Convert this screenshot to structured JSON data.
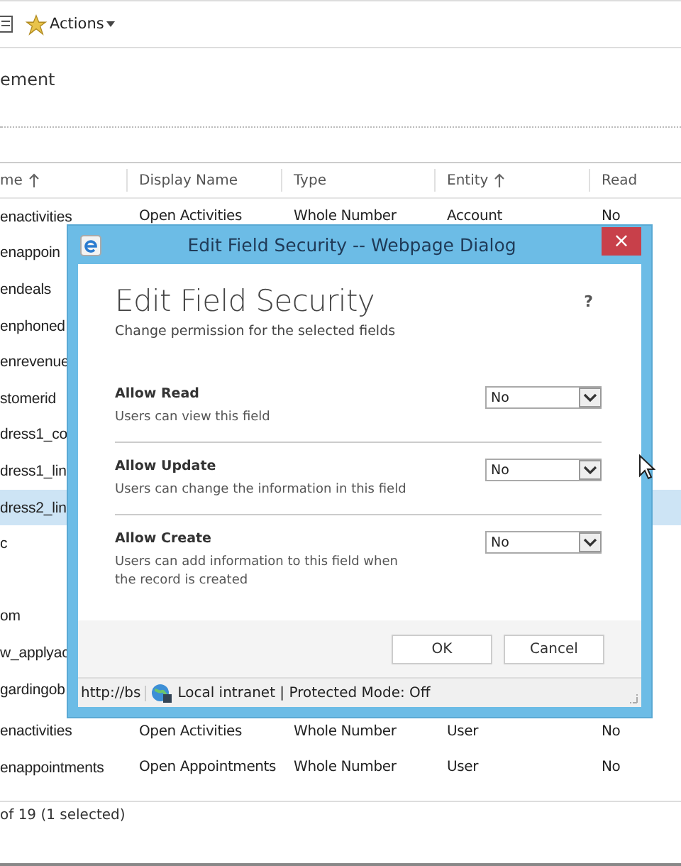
{
  "toolbar": {
    "actions_label": "Actions"
  },
  "page_title": "ement",
  "table": {
    "columns": [
      {
        "label": "me",
        "sorted": true
      },
      {
        "label": "Display Name",
        "sorted": false
      },
      {
        "label": "Type",
        "sorted": false
      },
      {
        "label": "Entity",
        "sorted": true
      },
      {
        "label": "Read",
        "sorted": false
      }
    ],
    "rows": [
      {
        "selected": false,
        "cells": [
          "enactivities",
          "Open Activities",
          "Whole Number",
          "Account",
          "No"
        ]
      },
      {
        "selected": false,
        "cells": [
          "enappoin"
        ]
      },
      {
        "selected": false,
        "cells": [
          "endeals"
        ]
      },
      {
        "selected": false,
        "cells": [
          "enphoned"
        ]
      },
      {
        "selected": false,
        "cells": [
          "enrevenue"
        ]
      },
      {
        "selected": false,
        "cells": [
          "stomerid"
        ]
      },
      {
        "selected": false,
        "cells": [
          "dress1_co"
        ]
      },
      {
        "selected": false,
        "cells": [
          "dress1_lin"
        ]
      },
      {
        "selected": true,
        "cells": [
          "dress2_lin"
        ]
      },
      {
        "selected": false,
        "cells": [
          "c"
        ]
      },
      {
        "selected": false
      },
      {
        "selected": false,
        "cells": [
          "om"
        ]
      },
      {
        "selected": false,
        "cells": [
          "w_applyac"
        ]
      },
      {
        "selected": false,
        "cells": [
          "gardingob"
        ]
      },
      {
        "selected": false,
        "cells": [
          "enactivities",
          "Open Activities",
          "Whole Number",
          "User",
          "No"
        ]
      },
      {
        "selected": false,
        "cells": [
          "enappointments",
          "Open Appointments",
          "Whole Number",
          "User",
          "No"
        ]
      }
    ]
  },
  "record_count": "of 19 (1 selected)",
  "dialog": {
    "title": "Edit Field Security -- Webpage Dialog",
    "close": "×",
    "heading": "Edit Field Security",
    "subtitle": "Change permission for the selected fields",
    "help": "?",
    "permissions": [
      {
        "label": "Allow Read",
        "description": "Users can view this field",
        "value": "No"
      },
      {
        "label": "Allow Update",
        "description": "Users can change the information in this field",
        "value": "No"
      },
      {
        "label": "Allow Create",
        "description": "Users can add information to this field when the record is created",
        "value": "No"
      }
    ],
    "buttons": [
      "OK",
      "Cancel"
    ],
    "status_url": "http://bs",
    "status_zone": "Local intranet | Protected Mode: Off"
  }
}
